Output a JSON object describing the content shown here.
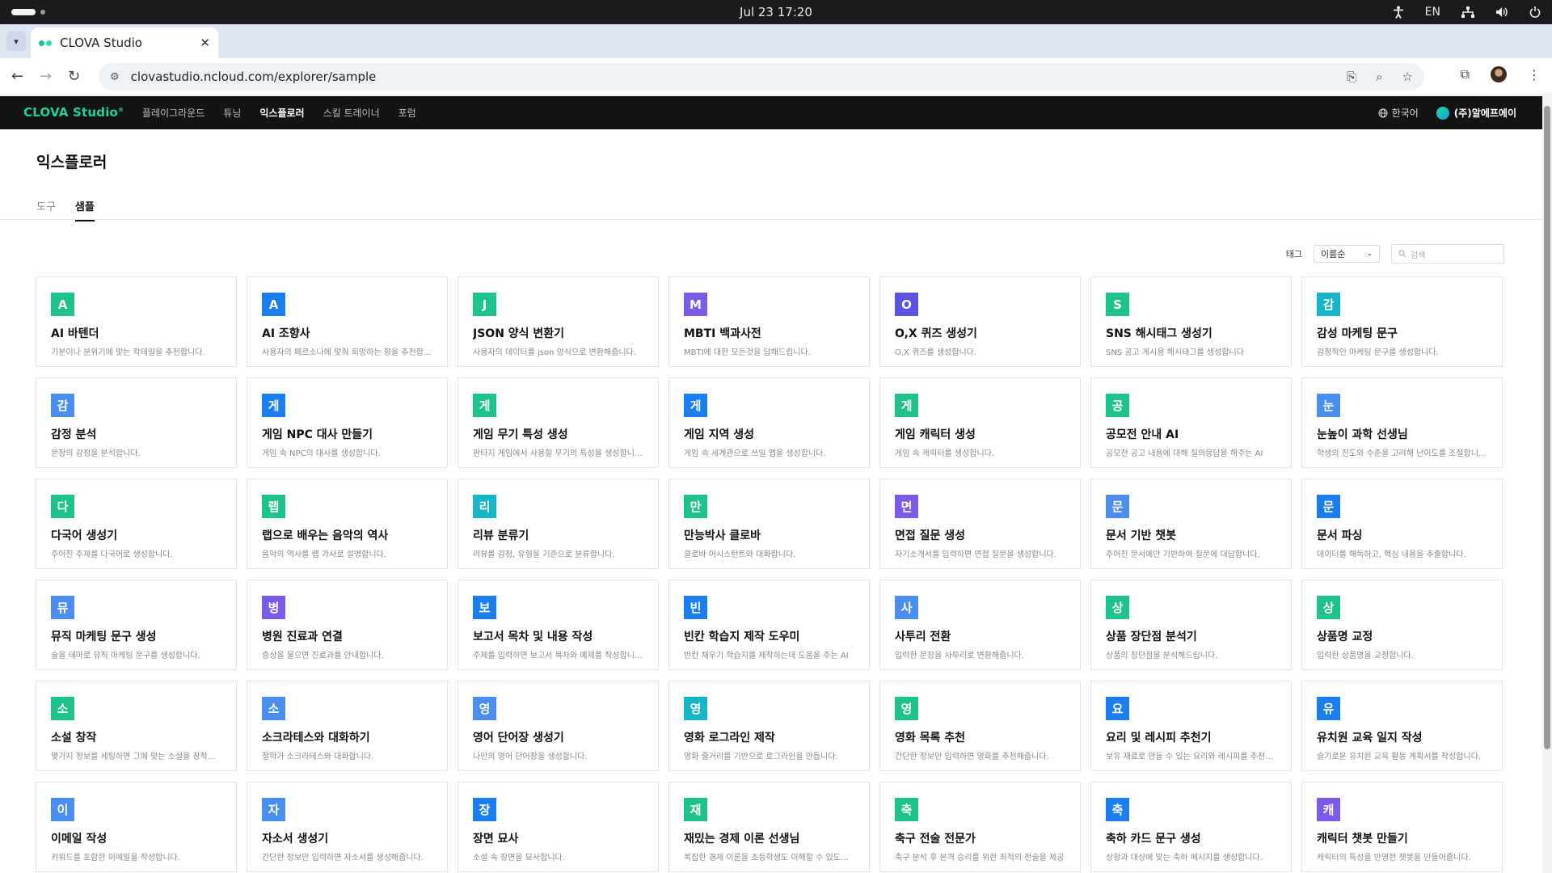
{
  "os": {
    "datetime": "Jul 23  17:20",
    "lang": "EN"
  },
  "browser": {
    "tab_title": "CLOVA Studio",
    "url": "clovastudio.ncloud.com/explorer/sample"
  },
  "app": {
    "logo": "CLOVA Studio",
    "logo_mark": "®",
    "nav": [
      "플레이그라운드",
      "튜닝",
      "익스플로러",
      "스킬 트레이너",
      "포럼"
    ],
    "active_nav": "익스플로러",
    "language": "한국어",
    "org": "(주)알에프에이"
  },
  "page": {
    "title": "익스플로러",
    "subtabs": [
      "도구",
      "샘플"
    ],
    "active_subtab": "샘플",
    "filter_label": "태그",
    "sort_value": "이름순",
    "search_placeholder": "검색"
  },
  "colors": {
    "green": "#1ec28b",
    "blue": "#1b7ef0",
    "purple": "#7a5ae6",
    "light_blue": "#4a9ef6",
    "teal": "#16b6c8"
  },
  "cards": [
    {
      "badge": "A",
      "color": "#1ec28b",
      "name": "AI 바텐더",
      "desc": "기분이나 분위기에 맞는 칵테일을 추천합니다."
    },
    {
      "badge": "A",
      "color": "#1b7ef0",
      "name": "AI 조향사",
      "desc": "사용자의 페르소나에 맞춰 희망하는 향을 추천합니다."
    },
    {
      "badge": "J",
      "color": "#1ec28b",
      "name": "JSON 양식 변환기",
      "desc": "사용자의 데이터를 json 양식으로 변환해줍니다."
    },
    {
      "badge": "M",
      "color": "#7a5ae6",
      "name": "MBTI 백과사전",
      "desc": "MBTI에 대한 모든것을 답해드립니다."
    },
    {
      "badge": "O",
      "color": "#5b52e0",
      "name": "O,X 퀴즈 생성기",
      "desc": "O,X 퀴즈를 생성합니다."
    },
    {
      "badge": "S",
      "color": "#1ec28b",
      "name": "SNS 해시태그 생성기",
      "desc": "SNS 공고 게시용 해시태그를 생성합니다"
    },
    {
      "badge": "감",
      "color": "#16b6c8",
      "name": "감성 마케팅 문구",
      "desc": "감정적인 마케팅 문구를 생성합니다."
    },
    {
      "badge": "감",
      "color": "#4a8ef0",
      "name": "감정 분석",
      "desc": "문장의 감정을 분석합니다."
    },
    {
      "badge": "게",
      "color": "#1b7ef0",
      "name": "게임 NPC 대사 만들기",
      "desc": "게임 속 NPC의 대사를 생성합니다."
    },
    {
      "badge": "게",
      "color": "#1ec28b",
      "name": "게임 무기 특성 생성",
      "desc": "판타지 게임에서 사용할 무기의 특성을 생성합니다."
    },
    {
      "badge": "게",
      "color": "#1b7ef0",
      "name": "게임 지역 생성",
      "desc": "게임 속 세계관으로 쓰일 맵을 생성합니다."
    },
    {
      "badge": "게",
      "color": "#1ec28b",
      "name": "게임 캐릭터 생성",
      "desc": "게임 속 캐릭터를 생성합니다."
    },
    {
      "badge": "공",
      "color": "#1ec28b",
      "name": "공모전 안내 AI",
      "desc": "공모전 공고 내용에 대해 질의응답을 해주는 AI"
    },
    {
      "badge": "눈",
      "color": "#4a8ef0",
      "name": "눈높이 과학 선생님",
      "desc": "학생의 진도와 수준을 고려해 난이도를 조절합니다."
    },
    {
      "badge": "다",
      "color": "#1ec28b",
      "name": "다국어 생성기",
      "desc": "주어진 주제를 다국어로 생성합니다."
    },
    {
      "badge": "랩",
      "color": "#1ec28b",
      "name": "랩으로 배우는 음악의 역사",
      "desc": "음악의 역사를 랩 가사로 설명합니다."
    },
    {
      "badge": "리",
      "color": "#16b6c8",
      "name": "리뷰 분류기",
      "desc": "리뷰를 감정, 유형을 기준으로 분류합니다."
    },
    {
      "badge": "만",
      "color": "#1ec28b",
      "name": "만능박사 클로바",
      "desc": "클로바 어시스턴트와 대화합니다."
    },
    {
      "badge": "면",
      "color": "#7a5ae6",
      "name": "면접 질문 생성",
      "desc": "자기소개서를 입력하면 면접 질문을 생성합니다."
    },
    {
      "badge": "문",
      "color": "#4a8ef0",
      "name": "문서 기반 챗봇",
      "desc": "주어진 문서에만 기반하여 질문에 대답합니다."
    },
    {
      "badge": "문",
      "color": "#1b7ef0",
      "name": "문서 파싱",
      "desc": "데이터를 해독하고, 핵심 내용을 추출합니다."
    },
    {
      "badge": "뮤",
      "color": "#4a8ef0",
      "name": "뮤직 마케팅 문구 생성",
      "desc": "술을 테마로 뮤직 마케팅 문구를 생성합니다."
    },
    {
      "badge": "병",
      "color": "#7a5ae6",
      "name": "병원 진료과 연결",
      "desc": "증상을 물으면 진료과를 안내합니다."
    },
    {
      "badge": "보",
      "color": "#1b7ef0",
      "name": "보고서 목차 및 내용 작성",
      "desc": "주제를 입력하면 보고서 목차와 예제를 작성합니다."
    },
    {
      "badge": "빈",
      "color": "#1b7ef0",
      "name": "빈칸 학습지 제작 도우미",
      "desc": "빈칸 채우기 학습지를 제작하는데 도움을 주는 AI"
    },
    {
      "badge": "사",
      "color": "#4a8ef0",
      "name": "사투리 전환",
      "desc": "입력한 문장을 사투리로 변환해줍니다."
    },
    {
      "badge": "상",
      "color": "#1ec28b",
      "name": "상품 장단점 분석기",
      "desc": "상품의 장단점을 분석해드립니다."
    },
    {
      "badge": "상",
      "color": "#1ec28b",
      "name": "상품명 교정",
      "desc": "입력한 상품명을 교정합니다."
    },
    {
      "badge": "소",
      "color": "#1ec28b",
      "name": "소설 창작",
      "desc": "몇가지 정보를 세팅하면 그에 맞는 소설을 창작합니다."
    },
    {
      "badge": "소",
      "color": "#4a8ef0",
      "name": "소크라테스와 대화하기",
      "desc": "철학가 소크라테스와 대화합니다."
    },
    {
      "badge": "영",
      "color": "#4a8ef0",
      "name": "영어 단어장 생성기",
      "desc": "나만의 영어 단어장을 생성합니다."
    },
    {
      "badge": "영",
      "color": "#16b6c8",
      "name": "영화 로그라인 제작",
      "desc": "영화 줄거리를 기반으로 로그라인을 만듭니다."
    },
    {
      "badge": "영",
      "color": "#1ec28b",
      "name": "영화 목록 추천",
      "desc": "간단한 정보만 입력하면 영화를 추천해줍니다."
    },
    {
      "badge": "요",
      "color": "#1b7ef0",
      "name": "요리 및 레시피 추천기",
      "desc": "보유 재료로 만들 수 있는 요리와 레시피를 추천합니다."
    },
    {
      "badge": "유",
      "color": "#1b7ef0",
      "name": "유치원 교육 일지 작성",
      "desc": "슬기로운 유치원 교육 활동 계획서를 작성합니다."
    },
    {
      "badge": "이",
      "color": "#4a8ef0",
      "name": "이메일 작성",
      "desc": "키워드를 포함한 이메일을 작성합니다."
    },
    {
      "badge": "자",
      "color": "#4a8ef0",
      "name": "자소서 생성기",
      "desc": "간단한 정보만 입력하면 자소서를 생성해줍니다."
    },
    {
      "badge": "장",
      "color": "#1b7ef0",
      "name": "장면 묘사",
      "desc": "소설 속 장면을 묘사합니다."
    },
    {
      "badge": "재",
      "color": "#1ec28b",
      "name": "재밌는 경제 이론 선생님",
      "desc": "복잡한 경제 이론을 초등학생도 이해할 수 있도록 설명합니다."
    },
    {
      "badge": "축",
      "color": "#1ec28b",
      "name": "축구 전술 전문가",
      "desc": "축구 분석 후 본격 승리를 위한 최적의 전술을 제공"
    },
    {
      "badge": "축",
      "color": "#1b7ef0",
      "name": "축하 카드 문구 생성",
      "desc": "상황과 대상에 맞는 축하 메시지를 생성합니다."
    },
    {
      "badge": "캐",
      "color": "#7a5ae6",
      "name": "캐릭터 챗봇 만들기",
      "desc": "캐릭터의 특성을 반영한 챗봇을 만들어줍니다."
    }
  ]
}
